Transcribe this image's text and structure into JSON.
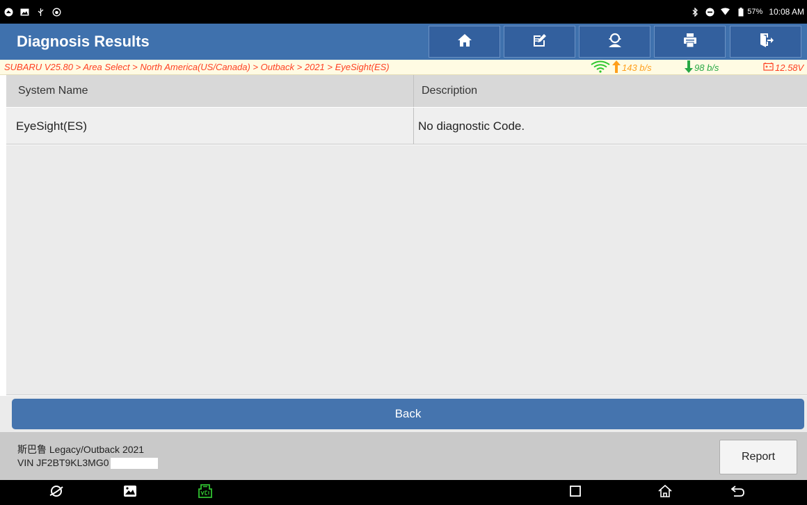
{
  "status_bar": {
    "battery": "57%",
    "time": "10:08 AM"
  },
  "header": {
    "title": "Diagnosis Results",
    "toolbar": [
      {
        "name": "home",
        "icon": "home-icon"
      },
      {
        "name": "edit",
        "icon": "edit-icon"
      },
      {
        "name": "support",
        "icon": "support-icon"
      },
      {
        "name": "print",
        "icon": "print-icon"
      },
      {
        "name": "exit",
        "icon": "exit-icon"
      }
    ]
  },
  "info_bar": {
    "breadcrumb": "SUBARU V25.80 > Area Select > North America(US/Canada) > Outback > 2021 > EyeSight(ES)",
    "upload": "143 b/s",
    "download": "98 b/s",
    "voltage": "12.58V"
  },
  "table": {
    "columns": [
      "System Name",
      "Description"
    ],
    "rows": [
      {
        "system_name": "EyeSight(ES)",
        "description": "No diagnostic Code."
      }
    ]
  },
  "footer": {
    "back_label": "Back",
    "vehicle": "斯巴鲁 Legacy/Outback 2021",
    "vin": "VIN JF2BT9KL3MG0",
    "report_label": "Report"
  },
  "colors": {
    "header": "#3f71ad",
    "toolbar_button": "#33609e",
    "breadcrumb_text": "#ff3f20",
    "upload_arrow": "#ff9f1c",
    "download_arrow": "#27a844",
    "wifi": "#2ec82e",
    "back_button": "#4574ae"
  }
}
